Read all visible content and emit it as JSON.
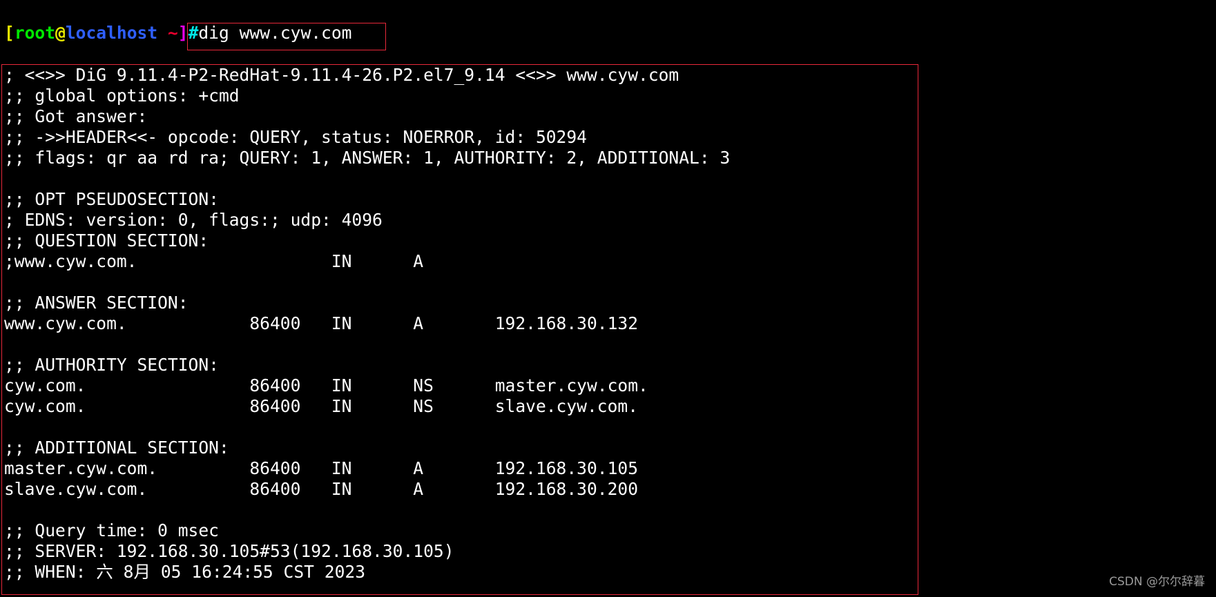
{
  "terminal": {
    "prompt": {
      "open_bracket": "[",
      "user": "root",
      "at": "@",
      "host": "localhost",
      "space": " ",
      "cwd": "~",
      "close_bracket": "]",
      "symbol": "#",
      "command": "dig www.cyw.com"
    },
    "output_lines": [
      "; <<>> DiG 9.11.4-P2-RedHat-9.11.4-26.P2.el7_9.14 <<>> www.cyw.com",
      ";; global options: +cmd",
      ";; Got answer:",
      ";; ->>HEADER<<- opcode: QUERY, status: NOERROR, id: 50294",
      ";; flags: qr aa rd ra; QUERY: 1, ANSWER: 1, AUTHORITY: 2, ADDITIONAL: 3",
      "",
      ";; OPT PSEUDOSECTION:",
      "; EDNS: version: 0, flags:; udp: 4096",
      ";; QUESTION SECTION:",
      ";www.cyw.com.                   IN      A",
      "",
      ";; ANSWER SECTION:",
      "www.cyw.com.            86400   IN      A       192.168.30.132",
      "",
      ";; AUTHORITY SECTION:",
      "cyw.com.                86400   IN      NS      master.cyw.com.",
      "cyw.com.                86400   IN      NS      slave.cyw.com.",
      "",
      ";; ADDITIONAL SECTION:",
      "master.cyw.com.         86400   IN      A       192.168.30.105",
      "slave.cyw.com.          86400   IN      A       192.168.30.200",
      "",
      ";; Query time: 0 msec",
      ";; SERVER: 192.168.30.105#53(192.168.30.105)",
      ";; WHEN: 六 8月 05 16:24:55 CST 2023"
    ]
  },
  "watermark": "CSDN @尔尔辞暮",
  "colors": {
    "background": "#000000",
    "text": "#ffffff",
    "highlight_border": "#e8283a"
  }
}
